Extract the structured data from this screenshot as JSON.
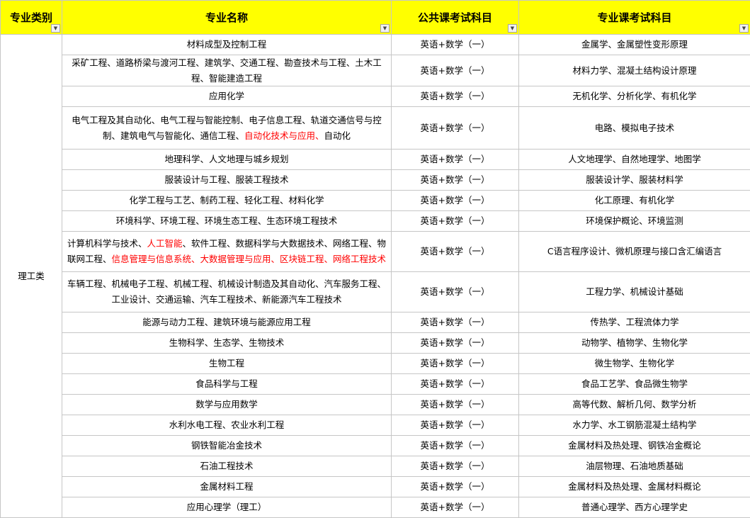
{
  "headers": {
    "category": "专业类别",
    "major": "专业名称",
    "public_exam": "公共课考试科目",
    "professional_exam": "专业课考试科目"
  },
  "filter_icon": "dropdown-arrow",
  "category_value": "理工类",
  "colors": {
    "header_bg": "#ffff00",
    "highlight_text": "#ff0000",
    "grid": "#c6c6c6"
  },
  "rows": [
    {
      "major": [
        {
          "t": "材料成型及控制工程"
        }
      ],
      "public": "英语+数学（一）",
      "prof": "金属学、金属塑性变形原理"
    },
    {
      "major": [
        {
          "t": "采矿工程、道路桥梁与渡河工程、建筑学、交通工程、勘查技术与工程、土木工程、智能建造工程"
        }
      ],
      "public": "英语+数学（一）",
      "prof": "材料力学、混凝土结构设计原理"
    },
    {
      "major": [
        {
          "t": "应用化学"
        }
      ],
      "public": "英语+数学（一）",
      "prof": "无机化学、分析化学、有机化学"
    },
    {
      "major": [
        {
          "t": "电气工程及其自动化、电气工程与智能控制、电子信息工程、轨道交通信号与控制、建筑电气与智能化、通信工程、"
        },
        {
          "t": "自动化技术与应用、",
          "red": true
        },
        {
          "t": "自动化"
        }
      ],
      "public": "英语+数学（一）",
      "prof": "电路、模拟电子技术"
    },
    {
      "major": [
        {
          "t": "地理科学、人文地理与城乡规划"
        }
      ],
      "public": "英语+数学（一）",
      "prof": "人文地理学、自然地理学、地图学"
    },
    {
      "major": [
        {
          "t": "服装设计与工程、服装工程技术"
        }
      ],
      "public": "英语+数学（一）",
      "prof": "服装设计学、服装材料学"
    },
    {
      "major": [
        {
          "t": "化学工程与工艺、制药工程、轻化工程、材料化学"
        }
      ],
      "public": "英语+数学（一）",
      "prof": "化工原理、有机化学"
    },
    {
      "major": [
        {
          "t": "环境科学、环境工程、环境生态工程、生态环境工程技术"
        }
      ],
      "public": "英语+数学（一）",
      "prof": "环境保护概论、环境监测"
    },
    {
      "major": [
        {
          "t": "计算机科学与技术、"
        },
        {
          "t": "人工智能",
          "red": true
        },
        {
          "t": "、软件工程、数据科学与大数据技术、网络工程、物联网工程、"
        },
        {
          "t": "信息管理与信息系统、大数据管理与应用、区块链工程、网络工程技术",
          "red": true
        }
      ],
      "public": "英语+数学（一）",
      "prof": "C语言程序设计、微机原理与接口含汇编语言"
    },
    {
      "major": [
        {
          "t": "车辆工程、机械电子工程、机械工程、机械设计制造及其自动化、汽车服务工程、工业设计、交通运输、汽车工程技术、新能源汽车工程技术"
        }
      ],
      "public": "英语+数学（一）",
      "prof": "工程力学、机械设计基础"
    },
    {
      "major": [
        {
          "t": "能源与动力工程、建筑环境与能源应用工程"
        }
      ],
      "public": "英语+数学（一）",
      "prof": "传热学、工程流体力学"
    },
    {
      "major": [
        {
          "t": "生物科学、生态学、生物技术"
        }
      ],
      "public": "英语+数学（一）",
      "prof": "动物学、植物学、生物化学"
    },
    {
      "major": [
        {
          "t": "生物工程"
        }
      ],
      "public": "英语+数学（一）",
      "prof": "微生物学、生物化学"
    },
    {
      "major": [
        {
          "t": "食品科学与工程"
        }
      ],
      "public": "英语+数学（一）",
      "prof": "食品工艺学、食品微生物学"
    },
    {
      "major": [
        {
          "t": "数学与应用数学"
        }
      ],
      "public": "英语+数学（一）",
      "prof": "高等代数、解析几何、数学分析"
    },
    {
      "major": [
        {
          "t": "水利水电工程、农业水利工程"
        }
      ],
      "public": "英语+数学（一）",
      "prof": "水力学、水工钢筋混凝土结构学"
    },
    {
      "major": [
        {
          "t": "钢铁智能冶金技术"
        }
      ],
      "public": "英语+数学（一）",
      "prof": "金属材料及热处理、钢铁冶金概论"
    },
    {
      "major": [
        {
          "t": "石油工程技术"
        }
      ],
      "public": "英语+数学（一）",
      "prof": "油层物理、石油地质基础"
    },
    {
      "major": [
        {
          "t": "金属材料工程"
        }
      ],
      "public": "英语+数学（一）",
      "prof": "金属材料及热处理、金属材料概论"
    },
    {
      "major": [
        {
          "t": "应用心理学（理工）"
        }
      ],
      "public": "英语+数学（一）",
      "prof": "普通心理学、西方心理学史"
    }
  ]
}
